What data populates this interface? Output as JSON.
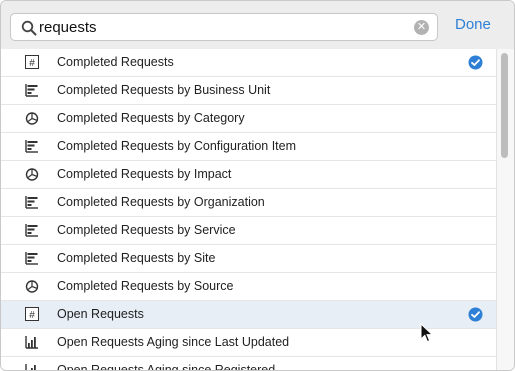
{
  "search": {
    "value": "requests",
    "clear_icon": "clear-icon",
    "done_label": "Done"
  },
  "rows": [
    {
      "label": "Completed Requests",
      "icon": "number-icon",
      "checked": true,
      "selected": false
    },
    {
      "label": "Completed Requests by Business Unit",
      "icon": "bar-chart-icon",
      "checked": false,
      "selected": false
    },
    {
      "label": "Completed Requests by Category",
      "icon": "pie-chart-icon",
      "checked": false,
      "selected": false
    },
    {
      "label": "Completed Requests by Configuration Item",
      "icon": "bar-chart-icon",
      "checked": false,
      "selected": false
    },
    {
      "label": "Completed Requests by Impact",
      "icon": "pie-chart-icon",
      "checked": false,
      "selected": false
    },
    {
      "label": "Completed Requests by Organization",
      "icon": "bar-chart-icon",
      "checked": false,
      "selected": false
    },
    {
      "label": "Completed Requests by Service",
      "icon": "bar-chart-icon",
      "checked": false,
      "selected": false
    },
    {
      "label": "Completed Requests by Site",
      "icon": "bar-chart-icon",
      "checked": false,
      "selected": false
    },
    {
      "label": "Completed Requests by Source",
      "icon": "pie-chart-icon",
      "checked": false,
      "selected": false
    },
    {
      "label": "Open Requests",
      "icon": "number-icon",
      "checked": true,
      "selected": true
    },
    {
      "label": "Open Requests Aging since Last Updated",
      "icon": "column-chart-icon",
      "checked": false,
      "selected": false
    },
    {
      "label": "Open Requests Aging since Registered",
      "icon": "column-chart-icon",
      "checked": false,
      "selected": false
    }
  ],
  "colors": {
    "accent": "#2d80d6",
    "selected_row": "#e8eef6"
  }
}
